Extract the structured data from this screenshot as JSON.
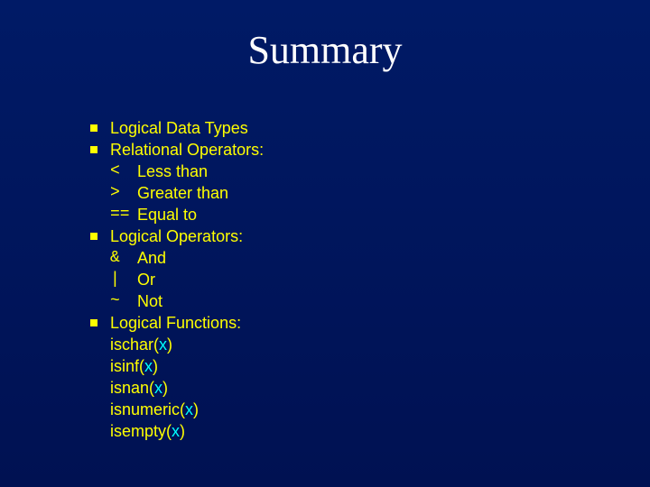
{
  "title": "Summary",
  "bullets": {
    "b0": "Logical Data Types",
    "b1": "Relational Operators:",
    "b2": "Logical Operators:",
    "b3": "Logical Functions:"
  },
  "rel_ops": {
    "r0_sym": "<",
    "r0_txt": "Less than",
    "r1_sym": ">",
    "r1_txt": "Greater than",
    "r2_sym": "==",
    "r2_txt": "Equal to"
  },
  "log_ops": {
    "l0_sym": "&",
    "l0_txt": "And",
    "l1_sym": "|",
    "l1_txt": "Or",
    "l2_sym": "~",
    "l2_txt": "Not"
  },
  "funcs": {
    "f0_name": "ischar",
    "f0_arg": "x",
    "f1_name": "isinf",
    "f1_arg": "x",
    "f2_name": "isnan",
    "f2_arg": "x",
    "f3_name": "isnumeric",
    "f3_arg": "x",
    "f4_name": "isempty",
    "f4_arg": "x"
  },
  "paren_open": "(",
  "paren_close": ")"
}
